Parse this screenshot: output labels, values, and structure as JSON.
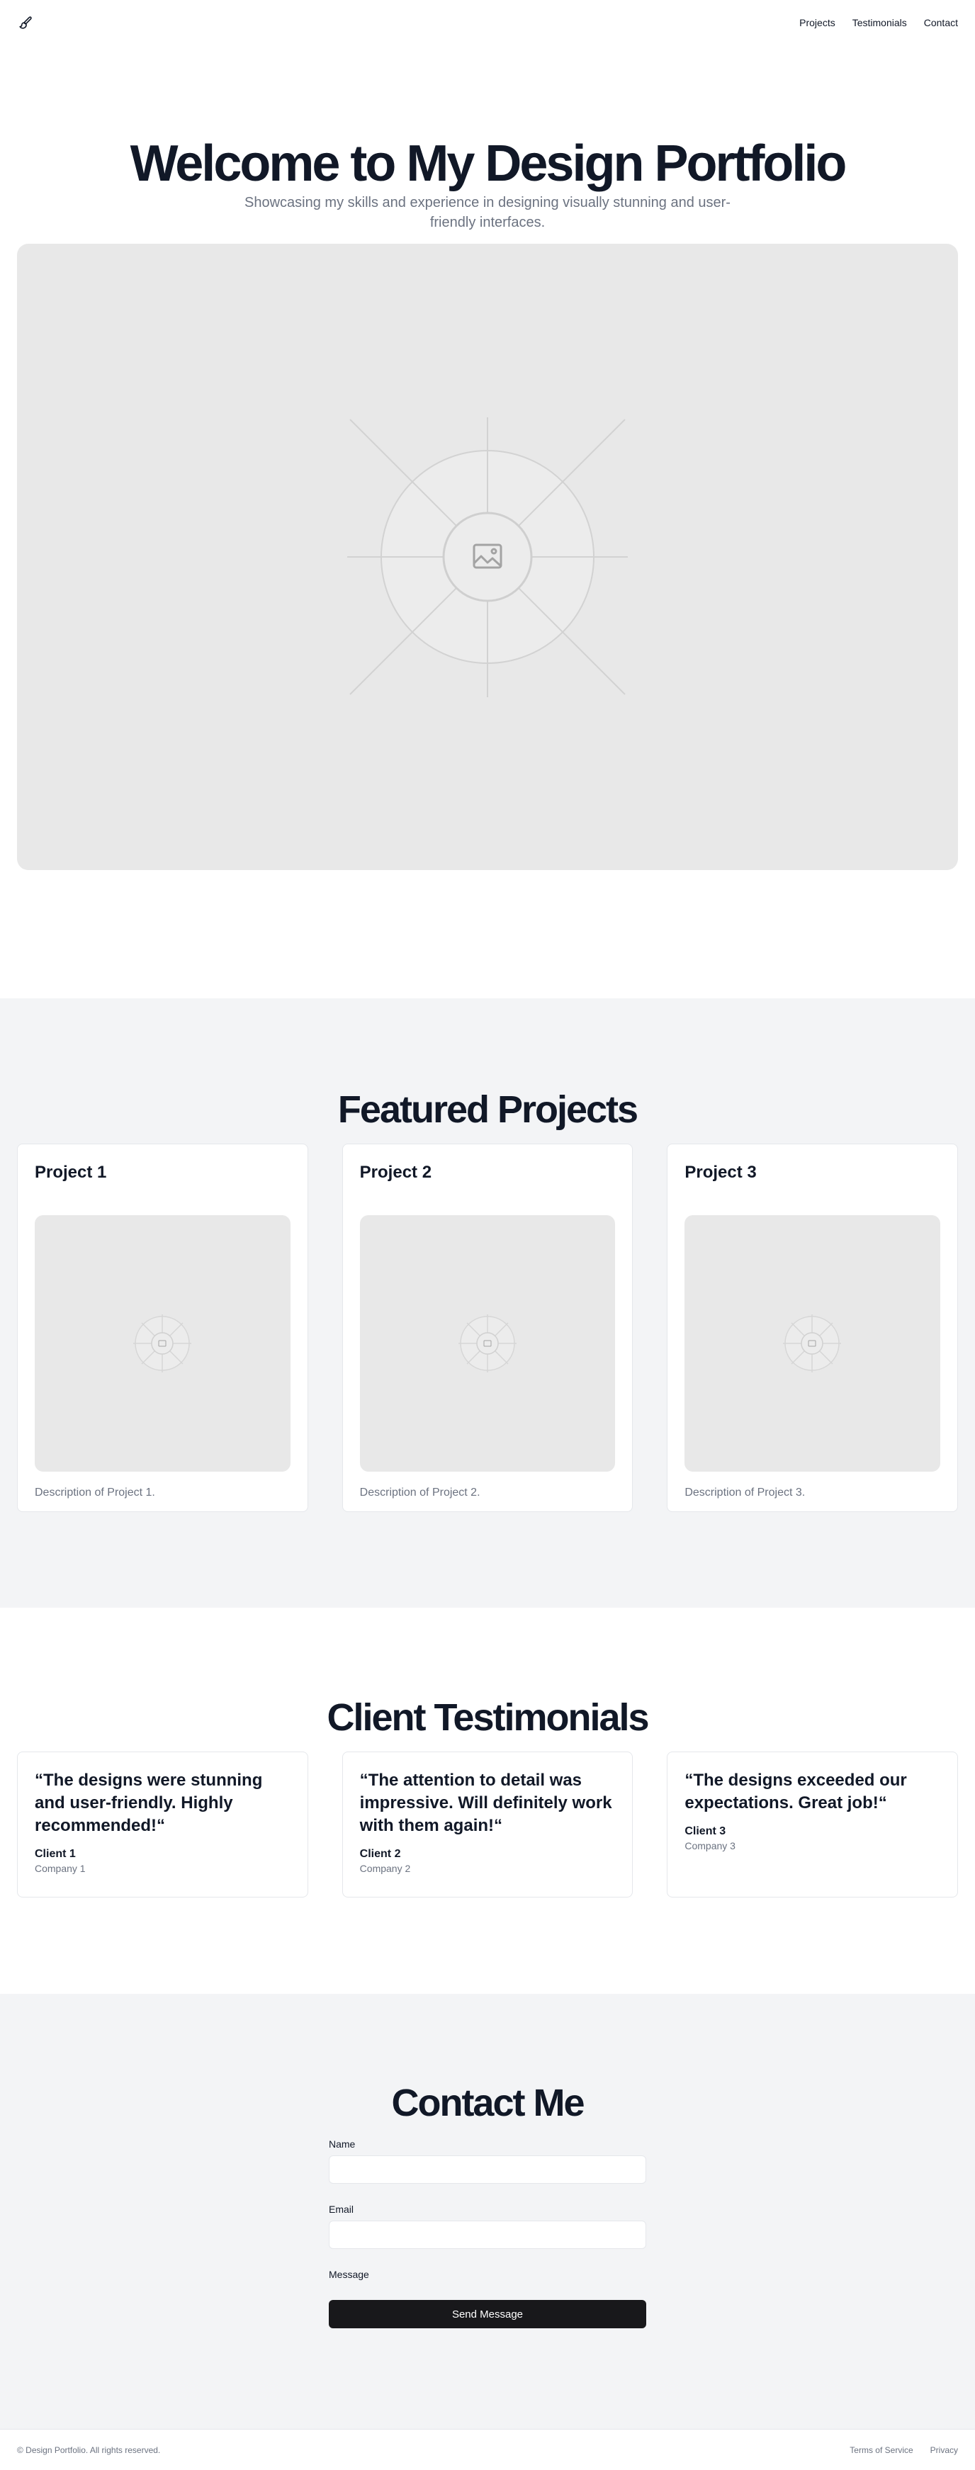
{
  "header": {
    "logo_icon": "paintbrush-icon",
    "nav": [
      {
        "label": "Projects"
      },
      {
        "label": "Testimonials"
      },
      {
        "label": "Contact"
      }
    ]
  },
  "hero": {
    "title": "Welcome to My Design Portfolio",
    "subtitle": "Showcasing my skills and experience in designing visually stunning and user-friendly interfaces.",
    "image_icon": "image-placeholder-icon"
  },
  "featured": {
    "title": "Featured Projects",
    "projects": [
      {
        "title": "Project 1",
        "description": "Description of Project 1."
      },
      {
        "title": "Project 2",
        "description": "Description of Project 2."
      },
      {
        "title": "Project 3",
        "description": "Description of Project 3."
      }
    ]
  },
  "testimonials": {
    "title": "Client Testimonials",
    "items": [
      {
        "quote": "“The designs were stunning and user-friendly. Highly recommended!“",
        "client": "Client 1",
        "company": "Company 1"
      },
      {
        "quote": "“The attention to detail was impressive. Will definitely work with them again!“",
        "client": "Client 2",
        "company": "Company 2"
      },
      {
        "quote": "“The designs exceeded our expectations. Great job!“",
        "client": "Client 3",
        "company": "Company 3"
      }
    ]
  },
  "contact": {
    "title": "Contact Me",
    "name_label": "Name",
    "name_value": "",
    "email_label": "Email",
    "email_value": "",
    "message_label": "Message",
    "submit_label": "Send Message"
  },
  "footer": {
    "copyright": "© Design Portfolio. All rights reserved.",
    "links": [
      {
        "label": "Terms of Service"
      },
      {
        "label": "Privacy"
      }
    ]
  },
  "colors": {
    "heading": "#111827",
    "muted": "#6b7280",
    "section_bg": "#f3f4f6",
    "placeholder_bg": "#e8e8e8",
    "button_bg": "#18181b"
  }
}
